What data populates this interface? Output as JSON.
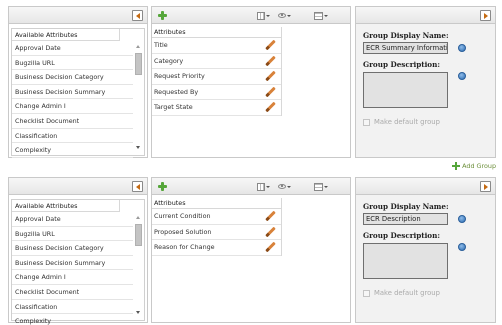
{
  "add_group_label": "Add Group",
  "colors": {
    "accent_orange": "#c46a12",
    "add_green": "#55a63a",
    "info_blue": "#2c6db3",
    "field_gray": "#e2e2e2"
  },
  "icons": {
    "collapse": "collapse-left-icon",
    "expand": "expand-right-icon",
    "add": "plus-icon",
    "edit": "pencil-icon",
    "info": "info-icon",
    "columns": "columns-icon",
    "view": "eye-icon",
    "grid": "grid-icon"
  },
  "groups": [
    {
      "available": {
        "header": "Available Attributes",
        "items": [
          "Approval Date",
          "Bugzilla URL",
          "Business Decision Category",
          "Business Decision Summary",
          "Change Admin I",
          "Checklist Document",
          "Classification",
          "Complexity"
        ]
      },
      "selected": {
        "header": "Attributes",
        "items": [
          "Title",
          "Category",
          "Request Priority",
          "Requested By",
          "Target State"
        ]
      },
      "settings": {
        "display_name_label": "Group Display Name:",
        "display_name_value": "ECR Summary Informatio",
        "description_label": "Group Description:",
        "description_value": "",
        "default_label": "Make default group"
      }
    },
    {
      "available": {
        "header": "Available Attributes",
        "items": [
          "Approval Date",
          "Bugzilla URL",
          "Business Decision Category",
          "Business Decision Summary",
          "Change Admin I",
          "Checklist Document",
          "Classification",
          "Complexity"
        ]
      },
      "selected": {
        "header": "Attributes",
        "items": [
          "Current Condition",
          "Proposed Solution",
          "Reason for Change"
        ]
      },
      "settings": {
        "display_name_label": "Group Display Name:",
        "display_name_value": "ECR Description",
        "description_label": "Group Description:",
        "description_value": "",
        "default_label": "Make default group"
      }
    }
  ]
}
